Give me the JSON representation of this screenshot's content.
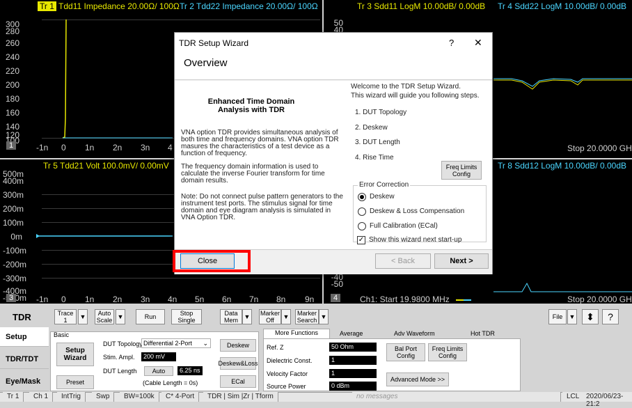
{
  "traces": {
    "tr1": {
      "num": "Tr 1",
      "label": "Tdd11 Impedance 20.00Ω/ 100Ω"
    },
    "tr2": {
      "label": "Tr 2  Tdd22 Impedance 20.00Ω/  100Ω"
    },
    "tr3": {
      "label": "Tr 3  Sdd11 LogM 10.00dB/ 0.00dB"
    },
    "tr4": {
      "label": "Tr 4  Sdd22 LogM 10.00dB/ 0.00dB"
    },
    "tr5": {
      "label": "Tr 5  Tdd21 Volt 100.0mV/ 0.00mV"
    },
    "tr8": {
      "label": "Tr 8  Sdd12 LogM 10.00dB/ 0.00dB"
    }
  },
  "pane1": {
    "yticks": [
      "300",
      "280",
      "260",
      "240",
      "220",
      "200",
      "180",
      "160",
      "140",
      "120",
      "100"
    ],
    "xticks": [
      "-1n",
      "0",
      "1n",
      "2n",
      "3n",
      "4"
    ],
    "corner": "1"
  },
  "pane2": {
    "yticks": [
      "50",
      "40"
    ],
    "stop": "Stop  20.0000 GH"
  },
  "pane3": {
    "yticks": [
      "500m",
      "400m",
      "300m",
      "200m",
      "100m",
      "0m",
      "-100m",
      "-200m",
      "-300m",
      "-400m",
      "-500m"
    ],
    "xticks": [
      "-1n",
      "0",
      "1n",
      "2n",
      "3n",
      "4n",
      "5n",
      "6n",
      "7n",
      "8n",
      "9n"
    ],
    "corner": "3"
  },
  "pane4": {
    "yticks": [
      "-40",
      "-50"
    ],
    "corner": "4",
    "start": "Ch1: Start  19.9800 MHz",
    "stop": "Stop  20.0000 GH"
  },
  "dialog": {
    "title": "TDR Setup Wizard",
    "help": "?",
    "close_x": "✕",
    "header": "Overview",
    "heading1": "Enhanced Time Domain",
    "heading2": "Analysis with TDR",
    "para1": "VNA option TDR provides simultaneous analysis of both time and frequency domains. VNA option TDR masures the characteristics of a test device as a function of frequency.",
    "para2": "The frequency domain information is used to calculate the inverse Fourier transform for time domain results.",
    "para3": "Note: Do not connect pulse pattern generators to the instrument test ports. The stimulus signal for time domain and eye diagram analysis is simulated in VNA Option TDR.",
    "welcome1": "Welcome to the TDR Setup Wizard.",
    "welcome2": "This wizard will guide you following steps.",
    "steps": [
      "1. DUT Topology",
      "2. Deskew",
      "3. DUT Length",
      "4. Rise Time"
    ],
    "freq_limits": "Freq Limits\nConfig",
    "error_group": "Error Correction",
    "radio_deskew": "Deskew",
    "radio_deskew_loss": "Deskew & Loss Compensation",
    "radio_full": "Full Calibration (ECal)",
    "show_wizard": "Show this wizard next start-up",
    "close_btn": "Close",
    "back_btn": "< Back",
    "next_btn": "Next >"
  },
  "toolbar": {
    "tdr": "TDR",
    "trace": "Trace\n1",
    "auto_scale": "Auto\nScale",
    "run": "Run",
    "stop_single": "Stop\nSingle",
    "data_mem": "Data\nMem",
    "marker_off": "Marker\nOff",
    "marker_search": "Marker\nSearch",
    "file": "File",
    "help": "?"
  },
  "side": {
    "setup": "Setup",
    "tdrtdt": "TDR/TDT",
    "eyemask": "Eye/Mask"
  },
  "basic": {
    "group": "Basic",
    "setup_wizard": "Setup\nWizard",
    "preset": "Preset",
    "dut_topology_label": "DUT Topology",
    "dut_topology_value": "Differential 2-Port",
    "stim_label": "Stim. Ampl.",
    "stim_value": "200 mV",
    "dut_length_label": "DUT Length",
    "auto": "Auto",
    "dut_length_value": "6.25 ns",
    "cable_length": "(Cable Length = 0s)",
    "deskew": "Deskew",
    "deskew_loss": "Deskew&Loss",
    "ecal": "ECal"
  },
  "tabs": [
    "More Functions",
    "Average",
    "Adv Waveform",
    "Hot TDR"
  ],
  "more": {
    "refz_label": "Ref. Z",
    "refz_value": "50 Ohm",
    "dielectric_label": "Dielectric Const.",
    "dielectric_value": "1",
    "velocity_label": "Velocity Factor",
    "velocity_value": "1",
    "source_power_label": "Source Power",
    "source_power_value": "0 dBm",
    "bal_port": "Bal Port\nConfig",
    "freq_limits": "Freq Limits\nConfig",
    "advanced": "Advanced Mode >>"
  },
  "status": {
    "tr": "Tr 1",
    "ch": "Ch 1",
    "trig": "IntTrig",
    "swp": "Swp",
    "bw": "BW=100k",
    "cport": "C* 4-Port",
    "mode": "TDR | Sim |Zr | Tform",
    "msg": "no messages",
    "lcl": "LCL",
    "date": "2020/06/23-21:2"
  },
  "colors": {
    "tr1": "#e8e800",
    "tr5": "#4bd6ff",
    "tr3": "#e8e800",
    "tr4": "#4bd6ff",
    "red_highlight": "#ff0000"
  }
}
